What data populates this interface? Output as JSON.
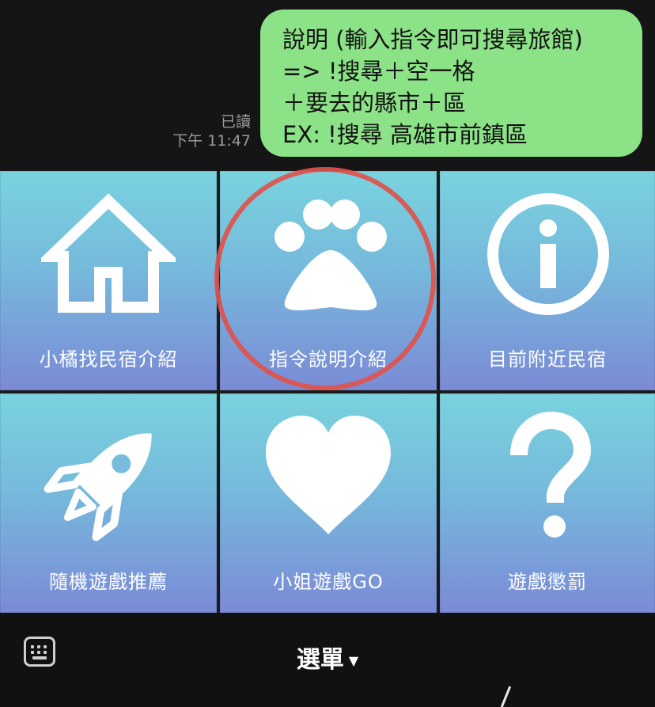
{
  "chat": {
    "message_lines": [
      "說明 (輸入指令即可搜尋旅館)",
      "=> !搜尋＋空一格",
      "＋要去的縣市＋區",
      "EX: !搜尋 高雄市前鎮區"
    ],
    "read_status": "已讀",
    "timestamp": "下午 11:47",
    "bubble_color": "#8ce287"
  },
  "menu": {
    "tiles": [
      {
        "label": "小橘找民宿介紹",
        "icon": "house-icon"
      },
      {
        "label": "指令說明介紹",
        "icon": "paw-icon"
      },
      {
        "label": "目前附近民宿",
        "icon": "info-icon"
      },
      {
        "label": "隨機遊戲推薦",
        "icon": "rocket-icon"
      },
      {
        "label": "小姐遊戲GO",
        "icon": "heart-icon"
      },
      {
        "label": "遊戲懲罰",
        "icon": "question-icon"
      }
    ],
    "gradient_top": "#79d3de",
    "gradient_bottom": "#7b8ad6",
    "highlight_color": "#e0524c"
  },
  "bottombar": {
    "toggle_label": "選單",
    "keyboard_icon": "keyboard-icon",
    "caret_icon": "caret-down-icon"
  }
}
